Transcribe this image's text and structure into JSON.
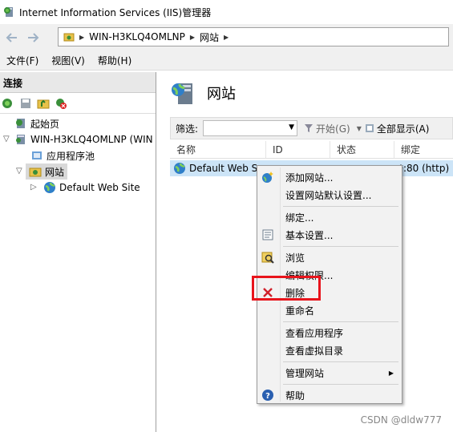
{
  "window": {
    "title": "Internet Information Services (IIS)管理器"
  },
  "navbar": {
    "breadcrumb": [
      "WIN-H3KLQ4OMLNP",
      "网站"
    ]
  },
  "menu": [
    "文件(F)",
    "视图(V)",
    "帮助(H)"
  ],
  "connections": {
    "header": "连接",
    "tree": [
      {
        "label": "起始页"
      },
      {
        "label": "WIN-H3KLQ4OMLNP (WIN"
      },
      {
        "label": "应用程序池"
      },
      {
        "label": "网站"
      },
      {
        "label": "Default Web Site"
      }
    ]
  },
  "main": {
    "title": "网站",
    "filter_label": "筛选:",
    "start_label": "开始(G)",
    "showall_label": "全部显示(A)",
    "columns": [
      "名称",
      "ID",
      "状态",
      "绑定"
    ],
    "row": {
      "name": "Default Web S",
      "binding": "*:80 (http)"
    }
  },
  "context_menu": {
    "items": [
      "添加网站...",
      "设置网站默认设置...",
      "绑定...",
      "基本设置...",
      "浏览",
      "编辑权限...",
      "删除",
      "重命名",
      "查看应用程序",
      "查看虚拟目录",
      "管理网站",
      "帮助"
    ],
    "highlight_color": "#e8141c"
  },
  "watermark": "CSDN @dldw777"
}
